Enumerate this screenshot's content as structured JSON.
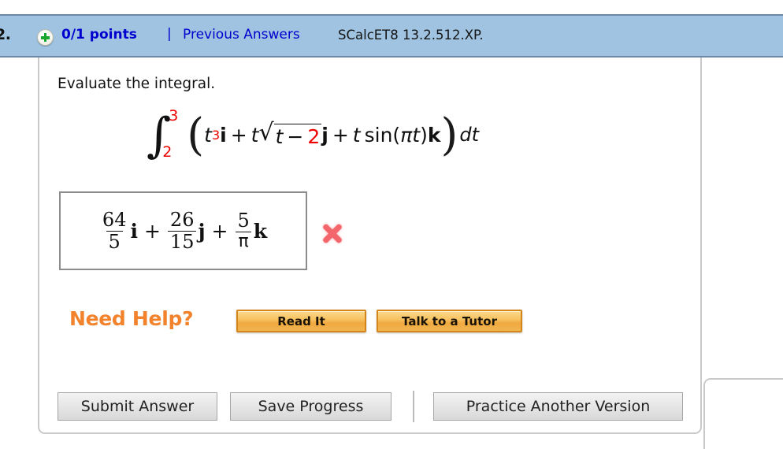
{
  "header": {
    "question_number": "2.",
    "status_icon": "plus-circle-icon",
    "points": "0/1 points",
    "separator": "|",
    "previous_answers_link": "Previous Answers",
    "problem_code": "SCalcET8 13.2.512.XP.",
    "bar_color": "#9fc3e0",
    "link_color": "#0000cf"
  },
  "prompt": {
    "text": "Evaluate the integral."
  },
  "integral": {
    "lower_limit": "2",
    "upper_limit": "3",
    "open_paren": "(",
    "close_paren": ")",
    "term1_var": "t",
    "term1_exp": "3",
    "term1_unit": "i",
    "plus1": "+",
    "term2_coef": "t",
    "sqrt_glyph": "√",
    "term2_radicand_var": "t",
    "term2_radicand_minus": "−",
    "term2_radicand_const": "2",
    "term2_unit": "j",
    "plus2": "+",
    "term3_coef": "t",
    "term3_fn": "sin(",
    "term3_pi": "π",
    "term3_var": "t",
    "term3_close": ")",
    "term3_unit": "k",
    "differential": "dt",
    "highlight_color": "#ee0000"
  },
  "answer": {
    "term1_numerator": "64",
    "term1_denominator": "5",
    "term1_unit": "i",
    "plus1": "+",
    "term2_numerator": "26",
    "term2_denominator": "15",
    "term2_unit": "j",
    "plus2": "+",
    "term3_numerator": "5",
    "term3_denominator": "π",
    "term3_unit": "k",
    "grade_icon": "x-mark-incorrect-icon",
    "grade_color": "#f2666c"
  },
  "help": {
    "label": "Need Help?",
    "label_color": "#f2832c",
    "read_it_label": "Read It",
    "tutor_label": "Talk to a Tutor"
  },
  "actions": {
    "submit_label": "Submit Answer",
    "save_label": "Save Progress",
    "practice_label": "Practice Another Version"
  }
}
